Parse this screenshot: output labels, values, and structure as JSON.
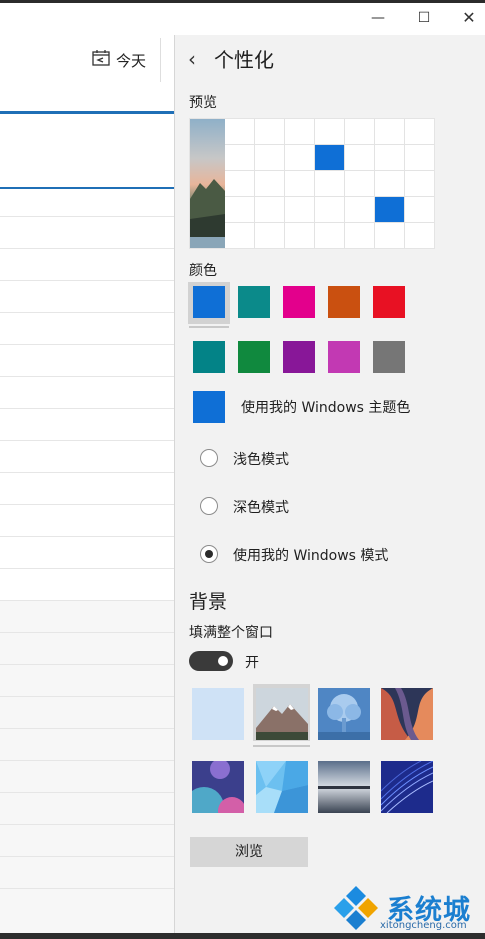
{
  "window": {
    "minimize_glyph": "—",
    "maximize_glyph": "☐",
    "close_glyph": "✕"
  },
  "calendar": {
    "today_label": "今天",
    "today_icon": "calendar-today-icon"
  },
  "panel": {
    "back_glyph": "‹",
    "title": "个性化",
    "preview_label": "预览",
    "color_label": "颜色",
    "colors_row1": [
      "#0f6fd6",
      "#0b8a8a",
      "#e3008c",
      "#ca5010",
      "#e81123"
    ],
    "colors_row2": [
      "#038387",
      "#10893e",
      "#881798",
      "#c239b3",
      "#767676"
    ],
    "selected_color": "#0f6fd6",
    "use_windows_color_label": "使用我的 Windows 主题色",
    "modes": [
      {
        "label": "浅色模式",
        "checked": false
      },
      {
        "label": "深色模式",
        "checked": false
      },
      {
        "label": "使用我的 Windows 模式",
        "checked": true
      }
    ],
    "background_title": "背景",
    "fill_window_label": "填满整个窗口",
    "toggle_state_label": "开",
    "toggle_on": true,
    "browse_label": "浏览"
  },
  "watermark": {
    "brand": "系统城",
    "url": "xitongcheng.com"
  }
}
